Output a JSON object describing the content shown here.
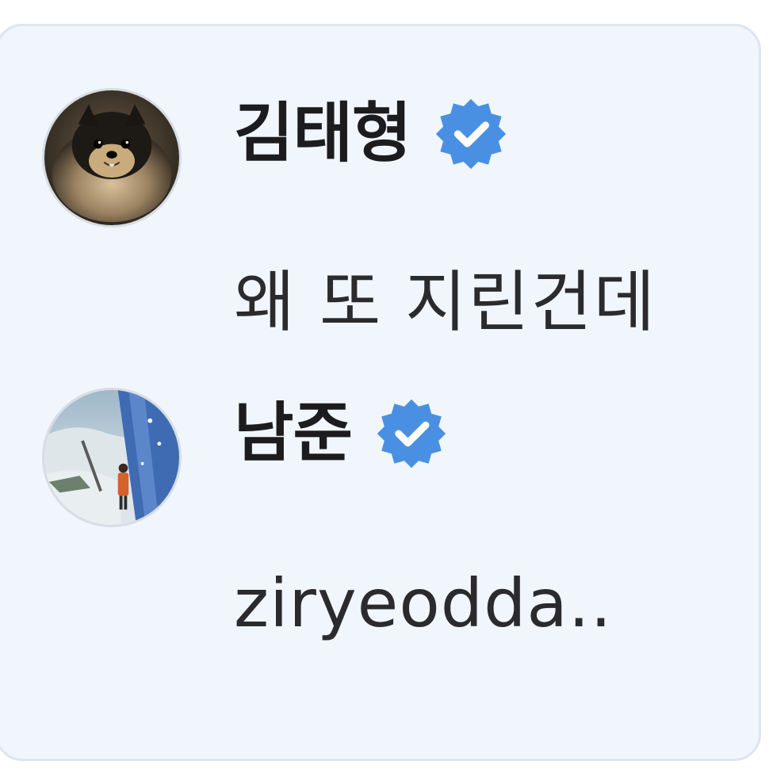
{
  "comments": [
    {
      "author": "김태형",
      "verified": true,
      "avatar_icon": "pomeranian-dog-photo",
      "text": "왜 또 지린건데"
    },
    {
      "author": "남준",
      "verified": true,
      "avatar_icon": "snowy-landscape-painting",
      "text": "ziryeodda.."
    }
  ],
  "colors": {
    "card_background": "#f0f6fc",
    "card_border": "#dbe6f0",
    "verified_badge": "#4a90e2",
    "name_text": "#1c1c1e",
    "body_text": "#2b2b2e"
  }
}
